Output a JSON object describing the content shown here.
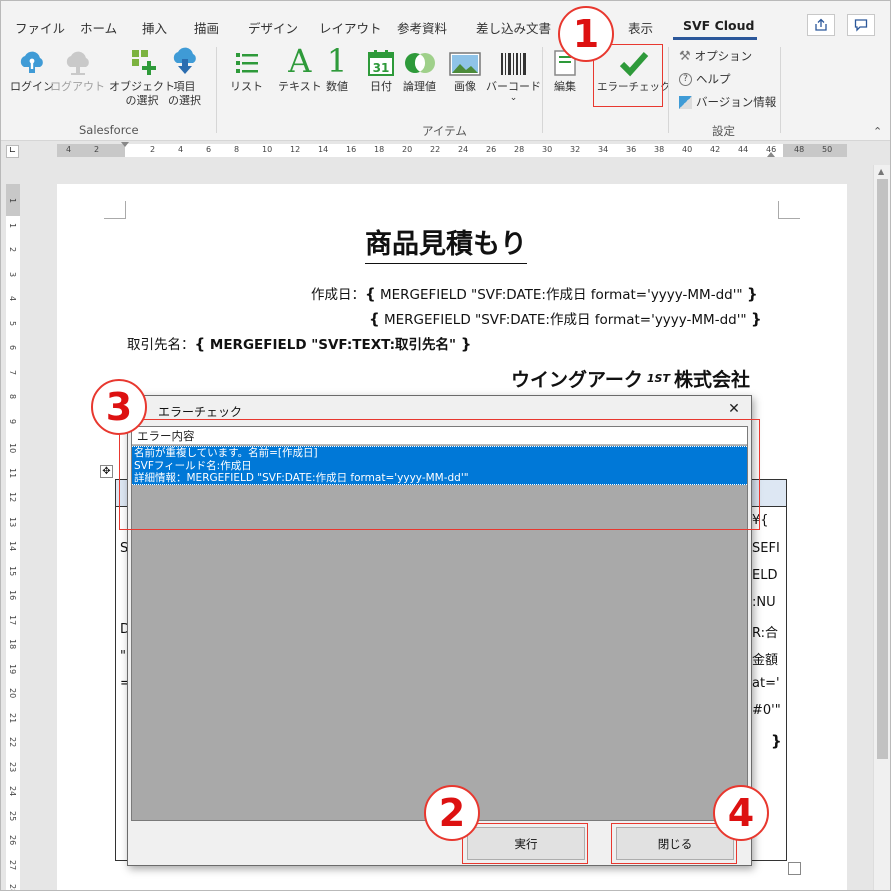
{
  "ribbon_tabs": [
    "ファイル",
    "ホーム",
    "挿入",
    "描画",
    "デザイン",
    "レイアウト",
    "参考資料",
    "差し込み文書",
    "表示",
    "SVF Cloud"
  ],
  "active_tab": "SVF Cloud",
  "ribbon": {
    "salesforce": {
      "login": "ログイン",
      "logout": "ログアウト",
      "select_object": "オブジェクト\nの選択",
      "select_item": "項目\nの選択",
      "group": "Salesforce"
    },
    "items": {
      "list": "リスト",
      "text": "テキスト",
      "number": "数値",
      "date": "日付",
      "logic": "論理値",
      "image": "画像",
      "barcode": "バーコード",
      "edit": "編集",
      "error_check": "エラーチェック",
      "group": "アイテム",
      "date_icon_num": "31",
      "text_icon": "A",
      "number_icon": "1"
    },
    "settings": {
      "options": "オプション",
      "help": "ヘルプ",
      "version": "バージョン情報",
      "group": "設定"
    }
  },
  "ruler_ticks": [
    "4",
    "2",
    "2",
    "4",
    "6",
    "8",
    "10",
    "12",
    "14",
    "16",
    "18",
    "20",
    "22",
    "24",
    "26",
    "28",
    "30",
    "32",
    "34",
    "36",
    "38",
    "40",
    "42",
    "44",
    "46",
    "48",
    "50"
  ],
  "vruler_ticks": [
    "1",
    "1",
    "2",
    "3",
    "4",
    "5",
    "6",
    "7",
    "8",
    "9",
    "10",
    "11",
    "12",
    "13",
    "14",
    "15",
    "16",
    "17",
    "18",
    "19",
    "20",
    "21",
    "22",
    "23",
    "24",
    "25",
    "26",
    "27",
    "28"
  ],
  "document": {
    "title": "商品見積もり",
    "line1_label": "作成日：",
    "line1_field": "MERGEFIELD \"SVF:DATE:作成日 format='yyyy-MM-dd'\"",
    "line2_field": "MERGEFIELD \"SVF:DATE:作成日 format='yyyy-MM-dd'\"",
    "line3_label": "取引先名：",
    "line3_field": "MERGEFIELD \"SVF:TEXT:取引先名\"",
    "company_pre": "ウイングアーク",
    "company_logo": "1ST",
    "company_post": "株式会社",
    "brace_open": "{",
    "brace_close": "}",
    "table_right": [
      "¥{",
      "SEFI",
      "ELD",
      ":NU",
      "R:合",
      "金額",
      "at='",
      "#0'\"",
      "}"
    ],
    "table_left": [
      "S",
      "",
      "",
      "D",
      "\"",
      "="
    ]
  },
  "dialog": {
    "title": "エラーチェック",
    "list_header": "エラー内容",
    "error_lines": [
      "名前が重複しています。名前=[作成日]",
      "SVFフィールド名:作成日",
      "詳細情報：MERGEFIELD \"SVF:DATE:作成日 format='yyyy-MM-dd'\""
    ],
    "run_button": "実行",
    "close_button": "閉じる",
    "close_glyph": "✕"
  },
  "callouts": [
    "1",
    "2",
    "3",
    "4"
  ],
  "colors": {
    "accent": "#2b579a",
    "callout": "#e8382f",
    "selection": "#0078d7",
    "check": "#2e9a3a"
  }
}
